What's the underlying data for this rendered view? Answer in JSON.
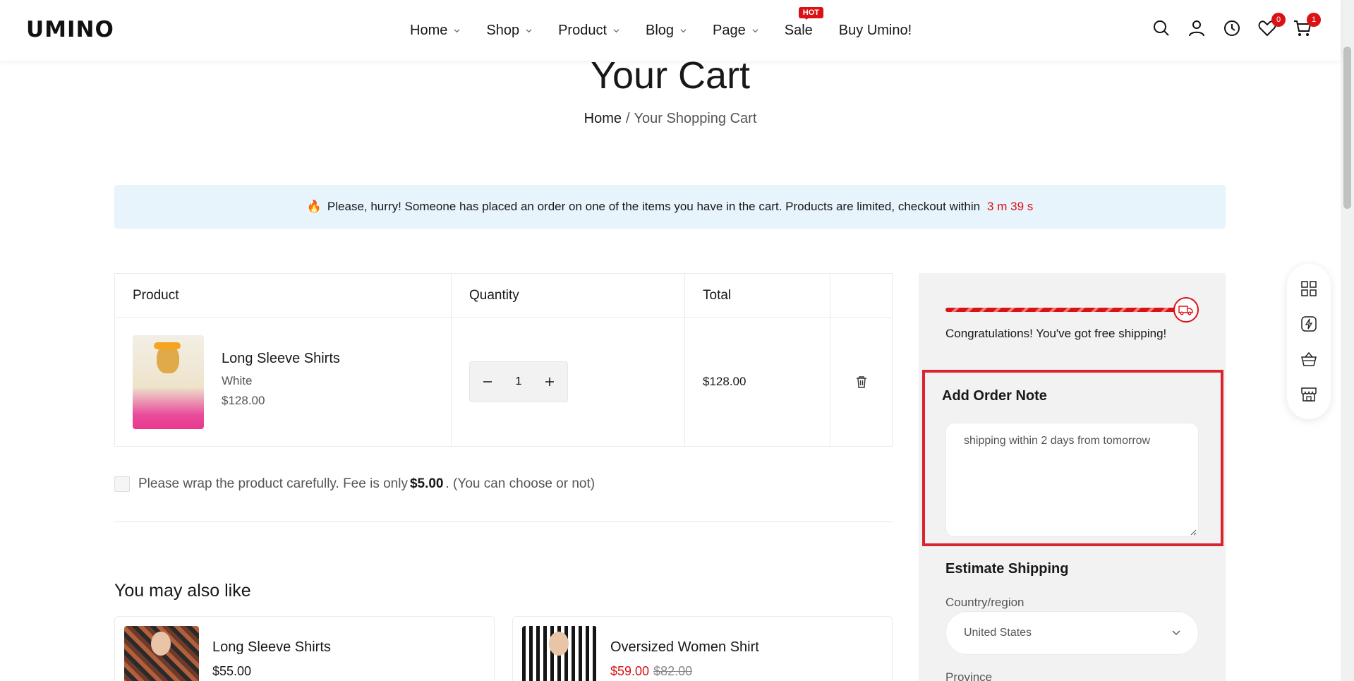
{
  "header": {
    "logo": "UMINO",
    "nav": [
      {
        "label": "Home",
        "has_dropdown": true
      },
      {
        "label": "Shop",
        "has_dropdown": true
      },
      {
        "label": "Product",
        "has_dropdown": true
      },
      {
        "label": "Blog",
        "has_dropdown": true
      },
      {
        "label": "Page",
        "has_dropdown": true
      },
      {
        "label": "Sale",
        "has_dropdown": false,
        "badge": "HOT"
      },
      {
        "label": "Buy Umino!",
        "has_dropdown": false
      }
    ],
    "wishlist_count": "0",
    "cart_count": "1",
    "icons": [
      "search-icon",
      "user-icon",
      "clock-icon",
      "heart-icon",
      "cart-icon"
    ]
  },
  "page": {
    "title": "Your Cart",
    "breadcrumb": {
      "home": "Home",
      "separator": "/",
      "current": "Your Shopping Cart"
    }
  },
  "banner": {
    "message": "Please, hurry! Someone has placed an order on one of the items you have in the cart. Products are limited, checkout within",
    "timer": "3 m 39 s"
  },
  "cart": {
    "headers": {
      "product": "Product",
      "quantity": "Quantity",
      "total": "Total"
    },
    "items": [
      {
        "name": "Long Sleeve Shirts",
        "variant": "White",
        "price": "$128.00",
        "quantity": "1",
        "total": "$128.00"
      }
    ]
  },
  "gift_wrap": {
    "text_before": "Please wrap the product carefully. Fee is only",
    "fee": "$5.00",
    "text_after": ". (You can choose or not)"
  },
  "recommendations": {
    "title": "You may also like",
    "items": [
      {
        "name": "Long Sleeve Shirts",
        "price": "$55.00"
      },
      {
        "name": "Oversized Women Shirt",
        "sale_price": "$59.00",
        "old_price": "$82.00"
      }
    ]
  },
  "sidebar": {
    "shipping_message": "Congratulations! You've got free shipping!",
    "shipping_progress": 1.0,
    "order_note": {
      "title": "Add Order Note",
      "value": "shipping within 2 days from tomorrow"
    },
    "estimate": {
      "title": "Estimate Shipping",
      "country_label": "Country/region",
      "country_value": "United States",
      "province_label": "Province"
    }
  },
  "colors": {
    "accent": "#db1215",
    "banner_bg": "#e8f4fc",
    "highlight_border": "#d9232d"
  }
}
